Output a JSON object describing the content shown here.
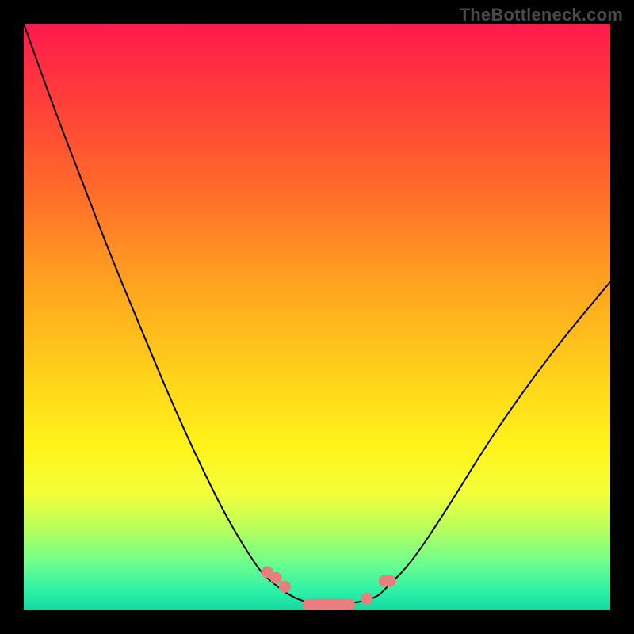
{
  "attribution": "TheBottleneck.com",
  "colors": {
    "frame": "#000000",
    "curve_stroke": "#000000",
    "marker_fill": "#e77f7f",
    "gradient_stops": [
      {
        "offset": 0.0,
        "hex": "#ff1a4d"
      },
      {
        "offset": 0.12,
        "hex": "#ff3b3b"
      },
      {
        "offset": 0.28,
        "hex": "#ff6a2a"
      },
      {
        "offset": 0.45,
        "hex": "#ffa51f"
      },
      {
        "offset": 0.6,
        "hex": "#ffd21a"
      },
      {
        "offset": 0.72,
        "hex": "#fff31a"
      },
      {
        "offset": 0.8,
        "hex": "#f3ff3a"
      },
      {
        "offset": 0.86,
        "hex": "#b8ff5c"
      },
      {
        "offset": 0.92,
        "hex": "#6cff8e"
      },
      {
        "offset": 0.97,
        "hex": "#29f0a8"
      },
      {
        "offset": 1.0,
        "hex": "#15d8a2"
      }
    ]
  },
  "chart_data": {
    "type": "line",
    "title": "",
    "xlabel": "",
    "ylabel": "",
    "xlim": [
      0,
      1
    ],
    "ylim": [
      0,
      1
    ],
    "grid": false,
    "legend": false,
    "categories": [],
    "series": [
      {
        "name": "bottleneck-curve",
        "x": [
          0.0,
          0.05,
          0.1,
          0.15,
          0.2,
          0.25,
          0.3,
          0.35,
          0.4,
          0.42,
          0.46,
          0.5,
          0.55,
          0.6,
          0.62,
          0.66,
          0.72,
          0.8,
          0.9,
          1.0
        ],
        "y": [
          1.0,
          0.86,
          0.73,
          0.6,
          0.48,
          0.36,
          0.25,
          0.15,
          0.07,
          0.05,
          0.02,
          0.01,
          0.01,
          0.02,
          0.04,
          0.08,
          0.17,
          0.3,
          0.44,
          0.56
        ]
      }
    ],
    "markers": [
      {
        "name": "left-cluster-dot-1",
        "x": 0.415,
        "y": 0.065
      },
      {
        "name": "left-cluster-dot-2",
        "x": 0.43,
        "y": 0.055
      },
      {
        "name": "left-cluster-dot-3",
        "x": 0.445,
        "y": 0.04
      },
      {
        "name": "trough-pill",
        "x": 0.52,
        "y": 0.01,
        "width": 0.09
      },
      {
        "name": "right-mid-dot",
        "x": 0.585,
        "y": 0.02
      },
      {
        "name": "right-cluster-pill",
        "x": 0.62,
        "y": 0.05,
        "width": 0.03
      }
    ]
  }
}
